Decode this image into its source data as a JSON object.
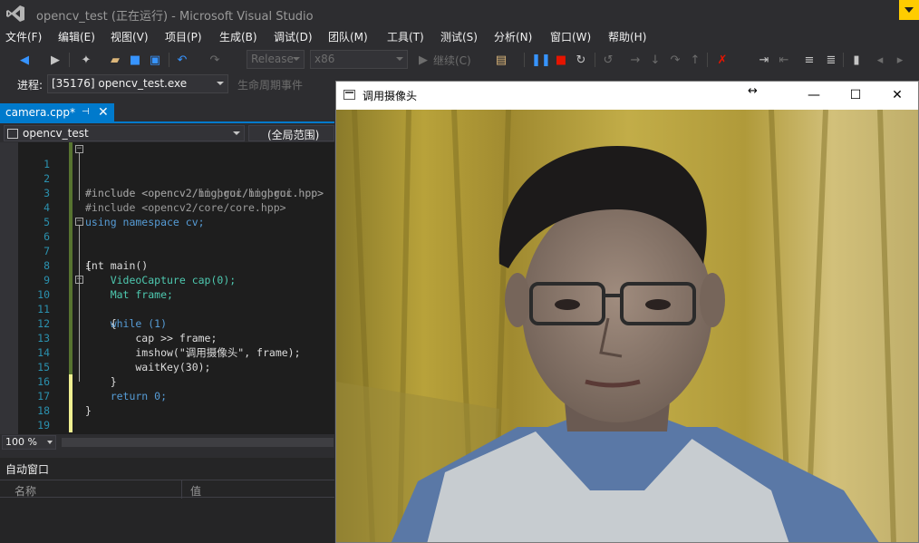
{
  "window": {
    "title": "opencv_test (正在运行) - Microsoft Visual Studio"
  },
  "menu": [
    "文件(F)",
    "编辑(E)",
    "视图(V)",
    "项目(P)",
    "生成(B)",
    "调试(D)",
    "团队(M)",
    "工具(T)",
    "测试(S)",
    "分析(N)",
    "窗口(W)",
    "帮助(H)"
  ],
  "toolbar": {
    "configuration": "Release",
    "platform": "x86",
    "continue_label": "继续(C)"
  },
  "process_bar": {
    "label": "进程:",
    "process": "[35176] opencv_test.exe",
    "lifecycle": "生命周期事件"
  },
  "editor_tab": {
    "label": "camera.cpp*"
  },
  "nav": {
    "project": "opencv_test",
    "scope": "(全局范围)"
  },
  "code_lines": [
    "#include <opencv2/highgui/highgui.hpp>",
    "#include <opencv2/imgproc/imgproc.hpp>",
    "#include <opencv2/core/core.hpp>",
    "using namespace cv;",
    "",
    "int main()",
    "{",
    "    VideoCapture cap(0);",
    "    Mat frame;",
    "    while (1)",
    "    {",
    "        cap >> frame;",
    "        imshow(\"调用摄像头\", frame);",
    "        waitKey(30);",
    "    }",
    "    return 0;",
    "}",
    "",
    "",
    ""
  ],
  "zoom": "100 %",
  "autos": {
    "title": "自动窗口",
    "col_name": "名称",
    "col_value": "值"
  },
  "camera_window": {
    "title": "调用摄像头"
  }
}
